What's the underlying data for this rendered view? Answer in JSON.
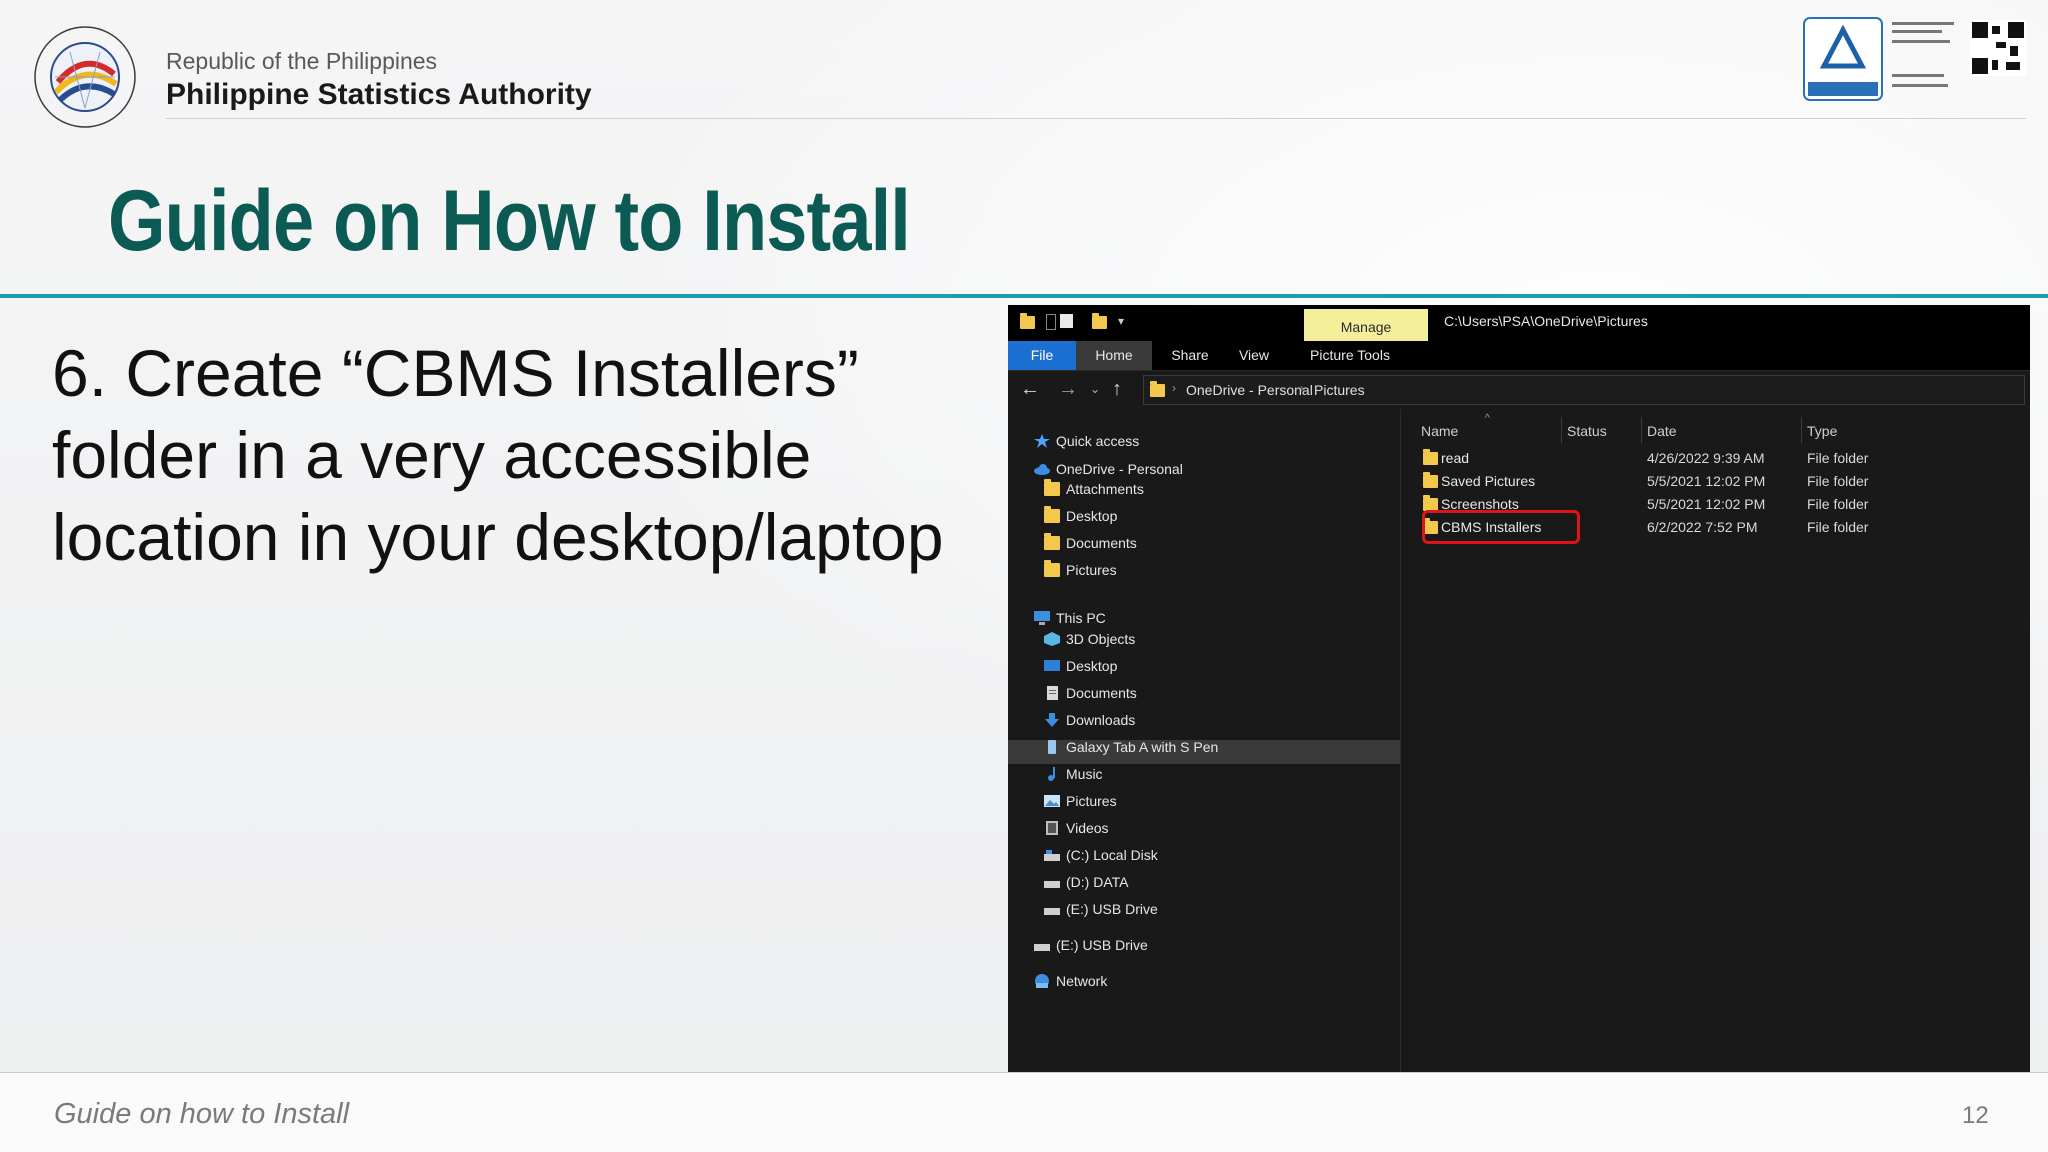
{
  "header": {
    "org_subtitle": "Republic of the Philippines",
    "org_name": "Philippine Statistics Authority"
  },
  "slide": {
    "title": "Guide on How to Install",
    "instruction_lines": [
      "6. Create “CBMS Installers”",
      "folder in a very accessible",
      "location in your desktop/laptop"
    ],
    "footer": "Guide on how to Install",
    "page_number": "12"
  },
  "explorer": {
    "contextual_tab": "Manage",
    "title_path": "C:\\Users\\PSA\\OneDrive\\Pictures",
    "ribbon_tabs": [
      "File",
      "Home",
      "Share",
      "View",
      "Picture Tools"
    ],
    "breadcrumb": [
      "OneDrive - Personal",
      "Pictures"
    ],
    "navigation": {
      "quick_access": "Quick access",
      "onedrive": "OneDrive - Personal",
      "onedrive_items": [
        "Attachments",
        "Desktop",
        "Documents",
        "Pictures"
      ],
      "this_pc": "This PC",
      "this_pc_items": [
        "3D Objects",
        "Desktop",
        "Documents",
        "Downloads",
        "Galaxy Tab A with S Pen",
        "Music",
        "Pictures",
        "Videos",
        "(C:) Local Disk",
        "(D:) DATA",
        "(E:) USB Drive"
      ],
      "usb_drive": "(E:) USB Drive",
      "network": "Network",
      "selected": "Pictures"
    },
    "columns": [
      "Name",
      "Status",
      "Date",
      "Type"
    ],
    "files": [
      {
        "name": "read",
        "date": "4/26/2022 9:39 AM",
        "type": "File folder"
      },
      {
        "name": "Saved Pictures",
        "date": "5/5/2021 12:02 PM",
        "type": "File folder"
      },
      {
        "name": "Screenshots",
        "date": "5/5/2021 12:02 PM",
        "type": "File folder"
      },
      {
        "name": "CBMS Installers",
        "date": "6/2/2022 7:52 PM",
        "type": "File folder"
      }
    ],
    "highlighted_file": "CBMS Installers",
    "colors": {
      "background": "#191919",
      "file_tab": "#1a6fd1",
      "manage_tab": "#f4ef9a",
      "folder": "#f2c94c",
      "highlight": "#e0131b"
    }
  },
  "icons": {
    "logo": "psa-seal-logo",
    "certification": "tuv-rheinland-certified-badge",
    "qr": "qr-code-icon"
  }
}
